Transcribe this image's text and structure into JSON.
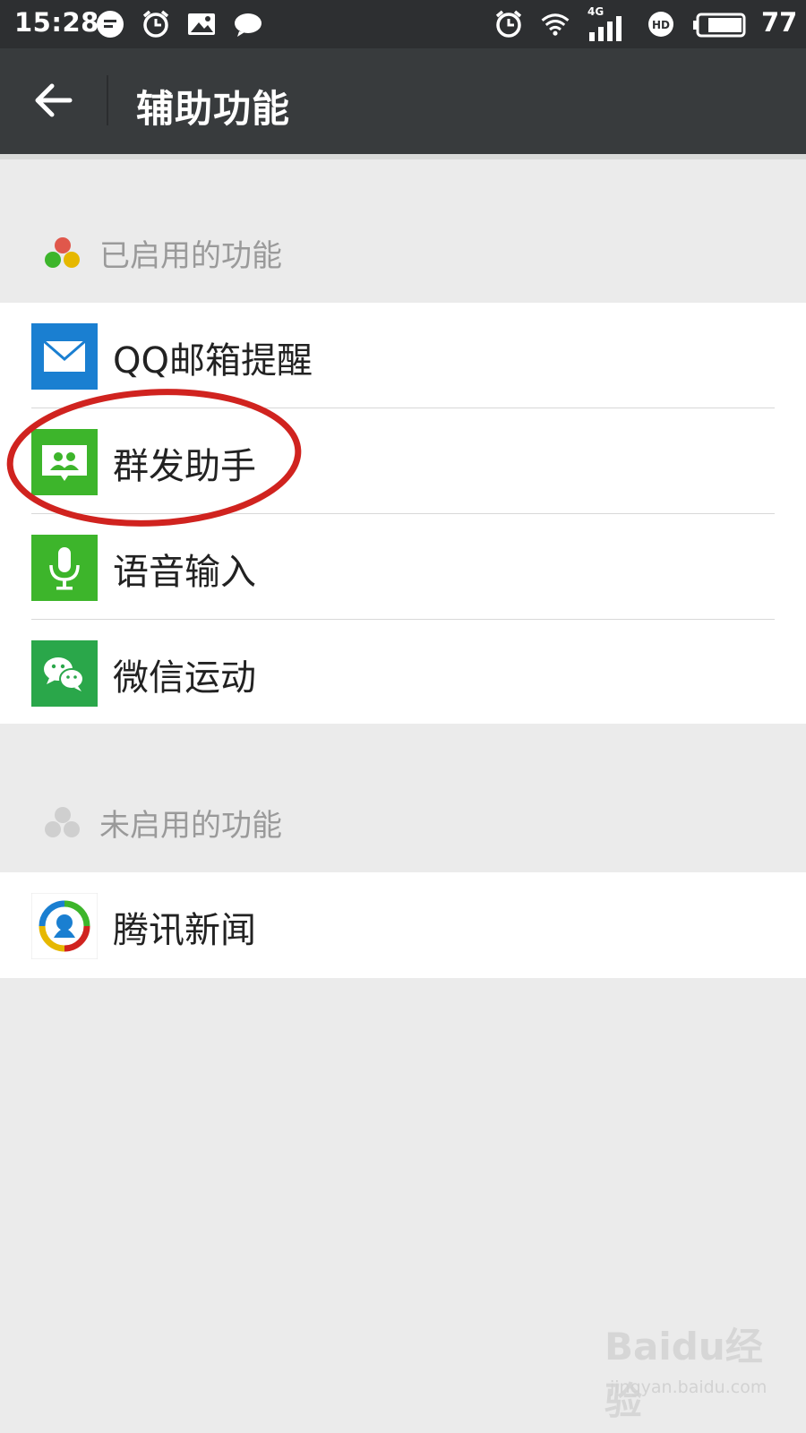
{
  "status_bar": {
    "time": "15:28",
    "network": "4G",
    "battery": "77",
    "left_icons": [
      "message-bubble-icon",
      "alarm-icon",
      "image-icon",
      "chat-icon"
    ],
    "right_icons": [
      "alarm-icon",
      "wifi-icon",
      "signal-icon",
      "hd-icon",
      "battery-icon"
    ]
  },
  "header": {
    "title": "辅助功能",
    "back_icon": "arrow-left-icon"
  },
  "enabled_section": {
    "label": "已启用的功能",
    "items": [
      {
        "label": "QQ邮箱提醒",
        "icon": "mail-icon",
        "color": "#1a7fd1"
      },
      {
        "label": "群发助手",
        "icon": "group-message-icon",
        "color": "#3db52b"
      },
      {
        "label": "语音输入",
        "icon": "microphone-icon",
        "color": "#3db52b"
      },
      {
        "label": "微信运动",
        "icon": "wechat-icon",
        "color": "#2aa74a"
      }
    ]
  },
  "disabled_section": {
    "label": "未启用的功能",
    "items": [
      {
        "label": "腾讯新闻",
        "icon": "tencent-news-icon",
        "color": "#ffffff"
      }
    ]
  },
  "colors": {
    "status_bar": "#2d2f31",
    "title_bar": "#383b3d",
    "background": "#ebebeb",
    "annotation_circle": "#d0231f"
  },
  "watermark": {
    "logo": "Baidu经验",
    "url": "jingyan.baidu.com"
  }
}
